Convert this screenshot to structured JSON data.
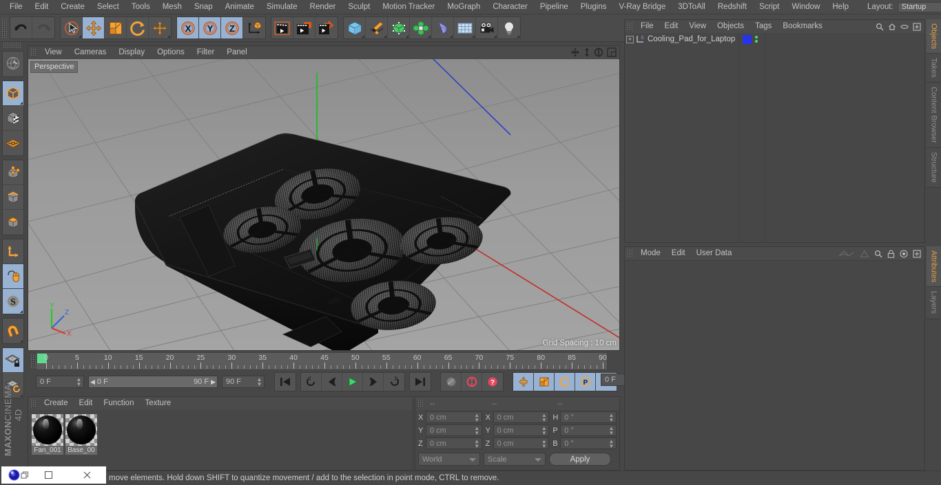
{
  "app": {
    "name": "MAXON CINEMA 4D",
    "brand_line1": "MAXON",
    "brand_line2": "CINEMA 4D"
  },
  "menubar": {
    "items": [
      {
        "label": "File"
      },
      {
        "label": "Edit"
      },
      {
        "label": "Create"
      },
      {
        "label": "Select"
      },
      {
        "label": "Tools"
      },
      {
        "label": "Mesh"
      },
      {
        "label": "Snap"
      },
      {
        "label": "Animate"
      },
      {
        "label": "Simulate"
      },
      {
        "label": "Render"
      },
      {
        "label": "Sculpt"
      },
      {
        "label": "Motion Tracker"
      },
      {
        "label": "MoGraph"
      },
      {
        "label": "Character"
      },
      {
        "label": "Pipeline"
      },
      {
        "label": "Plugins"
      },
      {
        "label": "V-Ray Bridge"
      },
      {
        "label": "3DToAll"
      },
      {
        "label": "Redshift"
      },
      {
        "label": "Script"
      },
      {
        "label": "Window"
      },
      {
        "label": "Help"
      }
    ],
    "layout_label": "Layout:",
    "layout_value": "Startup"
  },
  "toolbar": {
    "groups": [
      {
        "name": "history",
        "buttons": [
          {
            "icon": "undo-icon",
            "active": false
          },
          {
            "icon": "redo-icon",
            "active": false,
            "disabled": true
          }
        ]
      },
      {
        "name": "transform",
        "buttons": [
          {
            "icon": "live-selection-icon",
            "active": false
          },
          {
            "icon": "move-tool-icon",
            "active": true
          },
          {
            "icon": "scale-tool-icon",
            "active": false
          },
          {
            "icon": "rotate-tool-icon",
            "active": false
          },
          {
            "icon": "move-axis-icon",
            "active": false
          }
        ]
      },
      {
        "name": "axis-lock",
        "buttons": [
          {
            "icon": "axis-x-icon",
            "active": true
          },
          {
            "icon": "axis-y-icon",
            "active": true
          },
          {
            "icon": "axis-z-icon",
            "active": true
          },
          {
            "icon": "world-coordinate-icon",
            "active": false
          }
        ]
      },
      {
        "name": "render",
        "buttons": [
          {
            "icon": "render-view-icon",
            "active": false
          },
          {
            "icon": "render-region-icon",
            "active": false
          },
          {
            "icon": "render-settings-icon",
            "active": false
          }
        ]
      },
      {
        "name": "objects",
        "buttons": [
          {
            "icon": "cube-primitive-icon",
            "active": false
          },
          {
            "icon": "spline-pen-icon",
            "active": false
          },
          {
            "icon": "generator-icon",
            "active": false
          },
          {
            "icon": "mograph-cloner-icon",
            "active": false
          },
          {
            "icon": "deformer-bend-icon",
            "active": false
          },
          {
            "icon": "scene-environment-icon",
            "active": false
          },
          {
            "icon": "camera-icon",
            "active": false
          },
          {
            "icon": "light-icon",
            "active": false
          }
        ]
      }
    ]
  },
  "left_palette": {
    "groups": [
      {
        "buttons": [
          {
            "icon": "make-editable-icon",
            "active": false
          }
        ]
      },
      {
        "buttons": [
          {
            "icon": "model-mode-icon",
            "active": true
          },
          {
            "icon": "texture-mode-icon",
            "active": false
          },
          {
            "icon": "workplane-mode-icon",
            "active": false
          }
        ]
      },
      {
        "buttons": [
          {
            "icon": "points-mode-icon",
            "active": false
          },
          {
            "icon": "edges-mode-icon",
            "active": false
          },
          {
            "icon": "polygons-mode-icon",
            "active": false
          }
        ]
      },
      {
        "buttons": [
          {
            "icon": "object-axis-icon",
            "active": false
          },
          {
            "icon": "enable-axis-icon",
            "active": true
          },
          {
            "icon": "soft-selection-icon",
            "active": true
          }
        ]
      },
      {
        "buttons": [
          {
            "icon": "magnet-icon",
            "active": false
          }
        ]
      },
      {
        "buttons": [
          {
            "icon": "workplane-lock-icon",
            "active": true
          },
          {
            "icon": "workplane-reset-icon",
            "active": false
          }
        ]
      }
    ]
  },
  "viewport": {
    "menu": [
      {
        "label": "View"
      },
      {
        "label": "Cameras"
      },
      {
        "label": "Display"
      },
      {
        "label": "Options"
      },
      {
        "label": "Filter"
      },
      {
        "label": "Panel"
      }
    ],
    "gadgets": [
      {
        "icon": "pan-view-icon"
      },
      {
        "icon": "dolly-view-icon"
      },
      {
        "icon": "rotate-view-icon"
      },
      {
        "icon": "maximize-view-icon"
      }
    ],
    "perspective_label": "Perspective",
    "grid_spacing": "Grid Spacing : 10 cm",
    "axis_gizmo": {
      "x": "X",
      "y": "Y",
      "z": "Z",
      "x_color": "#d83a33",
      "y_color": "#3ecc4a",
      "z_color": "#3a63d8"
    },
    "scene_object": "Cooling_Pad_for_Laptop",
    "fan_count": 5
  },
  "timeline": {
    "ruler_start": 0,
    "ruler_end": 90,
    "major_ticks": [
      0,
      5,
      10,
      15,
      20,
      25,
      30,
      35,
      40,
      45,
      50,
      55,
      60,
      65,
      70,
      75,
      80,
      85,
      90
    ],
    "current_frame_field": "0 F",
    "range_start": "0 F",
    "range_end": "90 F",
    "max_frames_field": "90 F",
    "end_frame_field": "0 F",
    "transport": [
      {
        "icon": "go-to-start-icon"
      },
      {
        "icon": "play-reverse-loop-icon"
      },
      {
        "icon": "step-back-icon"
      },
      {
        "icon": "play-icon"
      },
      {
        "icon": "step-forward-icon"
      },
      {
        "icon": "play-forward-loop-icon"
      },
      {
        "icon": "go-to-end-icon"
      }
    ],
    "keyframe_tools": [
      {
        "icon": "record-key-mode-icon"
      },
      {
        "icon": "autokey-icon"
      },
      {
        "icon": "keyframe-selection-icon"
      }
    ],
    "key_axis_tools": [
      {
        "icon": "key-position-icon",
        "active": true
      },
      {
        "icon": "key-scale-icon",
        "active": true
      },
      {
        "icon": "key-rotation-icon",
        "active": true
      },
      {
        "icon": "key-param-icon",
        "active": true
      },
      {
        "icon": "key-points-icon",
        "active": true
      }
    ],
    "film_button": {
      "icon": "timeline-strip-icon",
      "active": true
    }
  },
  "material_manager": {
    "menu": [
      {
        "label": "Create"
      },
      {
        "label": "Edit"
      },
      {
        "label": "Function"
      },
      {
        "label": "Texture"
      }
    ],
    "materials": [
      {
        "name": "Fan_001"
      },
      {
        "name": "Base_00"
      }
    ]
  },
  "coordinate_manager": {
    "headers": [
      "--",
      "--",
      "--"
    ],
    "rows": [
      {
        "pos_label": "X",
        "pos_value": "0 cm",
        "size_label": "X",
        "size_value": "0 cm",
        "rot_label": "H",
        "rot_value": "0 °"
      },
      {
        "pos_label": "Y",
        "pos_value": "0 cm",
        "size_label": "Y",
        "size_value": "0 cm",
        "rot_label": "P",
        "rot_value": "0 °"
      },
      {
        "pos_label": "Z",
        "pos_value": "0 cm",
        "size_label": "Z",
        "size_value": "0 cm",
        "rot_label": "B",
        "rot_value": "0 °"
      }
    ],
    "system_value": "World",
    "mode_value": "Scale",
    "apply_label": "Apply"
  },
  "object_manager": {
    "menu": [
      {
        "label": "File"
      },
      {
        "label": "Edit"
      },
      {
        "label": "View"
      },
      {
        "label": "Objects"
      },
      {
        "label": "Tags"
      },
      {
        "label": "Bookmarks"
      }
    ],
    "head_icons": [
      {
        "icon": "search-icon"
      },
      {
        "icon": "home-icon"
      },
      {
        "icon": "ellipse-icon"
      },
      {
        "icon": "new-tab-icon"
      }
    ],
    "rows": [
      {
        "name": "Cooling_Pad_for_Laptop",
        "expandable": true,
        "object_icon": "null-object-icon",
        "tag_color": "#2732ef",
        "visibility_dots": 2
      }
    ]
  },
  "attribute_manager": {
    "menu": [
      {
        "label": "Mode"
      },
      {
        "label": "Edit"
      },
      {
        "label": "User Data"
      }
    ],
    "head_icons": [
      {
        "icon": "interpolation-icon"
      },
      {
        "icon": "triangle-icon"
      },
      {
        "icon": "search-icon"
      },
      {
        "icon": "lock-icon"
      },
      {
        "icon": "target-icon"
      },
      {
        "icon": "new-tab-icon"
      }
    ]
  },
  "right_tabs": {
    "top": [
      {
        "label": "Objects",
        "active": true
      },
      {
        "label": "Takes",
        "active": false
      },
      {
        "label": "Content Browser",
        "active": false
      },
      {
        "label": "Structure",
        "active": false
      }
    ],
    "bottom": [
      {
        "label": "Attributes",
        "active": true
      },
      {
        "label": "Layers",
        "active": false
      }
    ]
  },
  "statusbar": {
    "message": "move elements. Hold down SHIFT to quantize movement / add to the selection in point mode, CTRL to remove."
  },
  "taskbar": {
    "app_icon": "cinema4d-app-icon",
    "minimize_icon": "minimize-icon",
    "maximize_icon": "maximize-icon",
    "close_icon": "close-icon"
  },
  "colors": {
    "panel_bg": "#474747",
    "header_bg": "#4b4b4b",
    "active_blue": "#98b2d4",
    "accent_orange": "#e0a048",
    "viewport_bg": "#9a9a9a"
  }
}
